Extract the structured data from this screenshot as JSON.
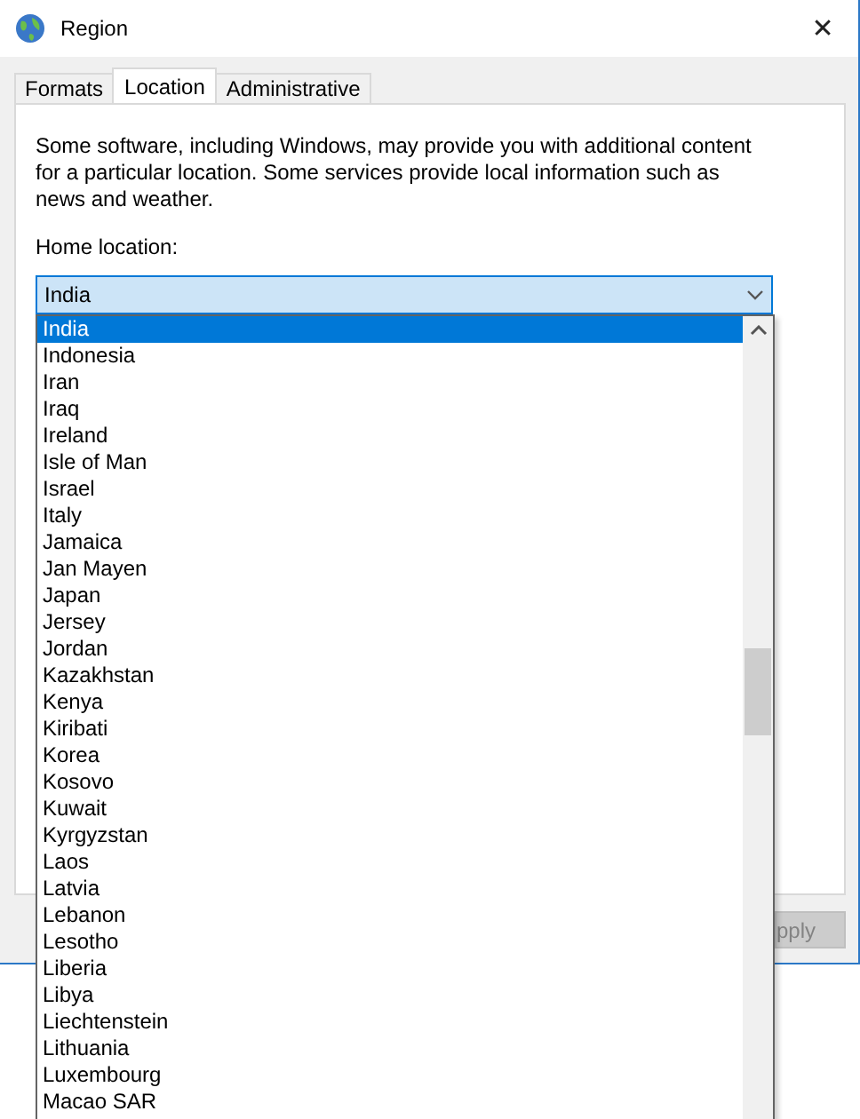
{
  "window": {
    "title": "Region",
    "close": "✕"
  },
  "tabs": [
    {
      "label": "Formats",
      "selected": false
    },
    {
      "label": "Location",
      "selected": true
    },
    {
      "label": "Administrative",
      "selected": false
    }
  ],
  "description": "Some software, including Windows, may provide you with additional content for a particular location. Some services provide local information such as news and weather.",
  "home_location": {
    "label": "Home location:",
    "value": "India",
    "expanded": true
  },
  "dropdown_items": [
    {
      "label": "India",
      "selected": true
    },
    {
      "label": "Indonesia",
      "selected": false
    },
    {
      "label": "Iran",
      "selected": false
    },
    {
      "label": "Iraq",
      "selected": false
    },
    {
      "label": "Ireland",
      "selected": false
    },
    {
      "label": "Isle of Man",
      "selected": false
    },
    {
      "label": "Israel",
      "selected": false
    },
    {
      "label": "Italy",
      "selected": false
    },
    {
      "label": "Jamaica",
      "selected": false
    },
    {
      "label": "Jan Mayen",
      "selected": false
    },
    {
      "label": "Japan",
      "selected": false
    },
    {
      "label": "Jersey",
      "selected": false
    },
    {
      "label": "Jordan",
      "selected": false
    },
    {
      "label": "Kazakhstan",
      "selected": false
    },
    {
      "label": "Kenya",
      "selected": false
    },
    {
      "label": "Kiribati",
      "selected": false
    },
    {
      "label": "Korea",
      "selected": false
    },
    {
      "label": "Kosovo",
      "selected": false
    },
    {
      "label": "Kuwait",
      "selected": false
    },
    {
      "label": "Kyrgyzstan",
      "selected": false
    },
    {
      "label": "Laos",
      "selected": false
    },
    {
      "label": "Latvia",
      "selected": false
    },
    {
      "label": "Lebanon",
      "selected": false
    },
    {
      "label": "Lesotho",
      "selected": false
    },
    {
      "label": "Liberia",
      "selected": false
    },
    {
      "label": "Libya",
      "selected": false
    },
    {
      "label": "Liechtenstein",
      "selected": false
    },
    {
      "label": "Lithuania",
      "selected": false
    },
    {
      "label": "Luxembourg",
      "selected": false
    },
    {
      "label": "Macao SAR",
      "selected": false
    }
  ],
  "buttons": [
    {
      "label": "pply",
      "disabled": true
    }
  ]
}
